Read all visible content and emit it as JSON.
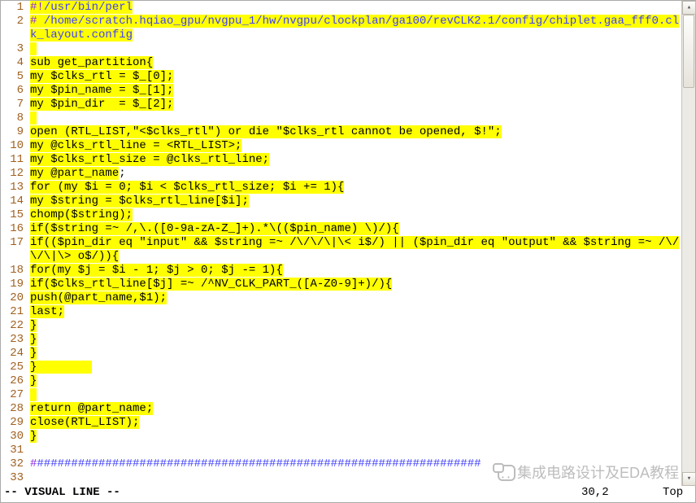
{
  "status": {
    "mode": "-- VISUAL LINE --",
    "pos": "30,2",
    "top": "Top"
  },
  "watermark": "集成电路设计及EDA教程",
  "gutter": [
    "1",
    "2",
    "",
    "3",
    "4",
    "5",
    "6",
    "7",
    "8",
    "9",
    "10",
    "11",
    "12",
    "13",
    "14",
    "15",
    "16",
    "17",
    "",
    "18",
    "19",
    "20",
    "21",
    "22",
    "23",
    "24",
    "25",
    "26",
    "27",
    "28",
    "29",
    "30",
    "31",
    "32",
    "33"
  ],
  "lines": [
    {
      "segs": [
        {
          "t": "#!",
          "c": "syn-pre sel"
        },
        {
          "t": "/usr/bin/perl",
          "c": "syn-cmt sel"
        }
      ]
    },
    {
      "segs": [
        {
          "t": "#",
          "c": "syn-hash sel"
        },
        {
          "t": " /home/scratch.hqiao_gpu/nvgpu_1/hw/nvgpu/clockplan/ga100/revCLK2.1/config/chiplet.gaa_fff0.clk_layout.config",
          "c": "syn-cmt sel"
        }
      ]
    },
    {
      "segs": [
        {
          "t": " ",
          "c": "sel"
        }
      ]
    },
    {
      "segs": [
        {
          "t": "sub get_partition{",
          "c": "sel"
        }
      ]
    },
    {
      "segs": [
        {
          "t": "my $clks_rtl = $_[0];",
          "c": "sel"
        }
      ]
    },
    {
      "segs": [
        {
          "t": "my $pin_name = $_[1];",
          "c": "sel"
        }
      ]
    },
    {
      "segs": [
        {
          "t": "my $pin_dir  = $_[2];",
          "c": "sel"
        }
      ]
    },
    {
      "segs": [
        {
          "t": " ",
          "c": "sel"
        }
      ]
    },
    {
      "segs": [
        {
          "t": "open (RTL_LIST,\"<$clks_rtl\") or die \"$clks_rtl cannot be opened, $!\";",
          "c": "sel"
        }
      ]
    },
    {
      "segs": [
        {
          "t": "my @clks_rtl_line = <RTL_LIST>;",
          "c": "sel"
        }
      ]
    },
    {
      "segs": [
        {
          "t": "my $clks_rtl_size = @clks_rtl_line;",
          "c": "sel"
        }
      ]
    },
    {
      "segs": [
        {
          "t": "my @part_name",
          "c": "sel"
        },
        {
          "t": ";",
          "c": ""
        }
      ]
    },
    {
      "segs": [
        {
          "t": "for (my $i = 0; $i < $clks_rtl_size; $i += 1){",
          "c": "sel"
        }
      ]
    },
    {
      "segs": [
        {
          "t": "my $string = $clks_rtl_line[$i];",
          "c": "sel"
        }
      ]
    },
    {
      "segs": [
        {
          "t": "chomp($string);",
          "c": "sel"
        }
      ]
    },
    {
      "segs": [
        {
          "t": "if($string =~ /,\\.([0-9a-zA-Z_]+).*\\(($pin_name) \\)/){",
          "c": "sel"
        }
      ]
    },
    {
      "segs": [
        {
          "t": "if(($pin_dir eq \"input\" && $string =~ /\\/\\/\\|\\< i$/) || ($pin_dir eq \"output\" && $string =~ /\\/\\/\\|\\> o$/)){",
          "c": "sel"
        }
      ]
    },
    {
      "segs": [
        {
          "t": "for(my $j = $i - 1; $j > 0; $j -= 1){",
          "c": "sel"
        }
      ]
    },
    {
      "segs": [
        {
          "t": "if($clks_rtl_line[$j] =~ /^NV_CLK_PART_([A-Z0-9]+)/){",
          "c": "sel"
        }
      ]
    },
    {
      "segs": [
        {
          "t": "push(@part_name,$1);",
          "c": "sel"
        }
      ]
    },
    {
      "segs": [
        {
          "t": "last;",
          "c": "sel"
        }
      ]
    },
    {
      "segs": [
        {
          "t": "}",
          "c": "sel"
        }
      ]
    },
    {
      "segs": [
        {
          "t": "}",
          "c": "sel"
        }
      ]
    },
    {
      "segs": [
        {
          "t": "}",
          "c": "sel"
        }
      ]
    },
    {
      "segs": [
        {
          "t": "}",
          "c": "sel"
        },
        {
          "t": "        ",
          "c": "sel"
        }
      ]
    },
    {
      "segs": [
        {
          "t": "}",
          "c": "sel"
        }
      ]
    },
    {
      "segs": [
        {
          "t": " ",
          "c": "sel"
        }
      ]
    },
    {
      "segs": [
        {
          "t": "return @part_name;",
          "c": "sel"
        }
      ]
    },
    {
      "segs": [
        {
          "t": "close(RTL_LIST);",
          "c": "sel"
        }
      ]
    },
    {
      "segs": [
        {
          "t": "}",
          "c": "sel"
        }
      ]
    },
    {
      "segs": [
        {
          "t": "",
          "c": ""
        }
      ]
    },
    {
      "segs": [
        {
          "t": "#",
          "c": "syn-hash"
        },
        {
          "t": "########################################################",
          "c": "syn-cmt"
        },
        {
          "t": "#########",
          "c": "syn-cmt"
        }
      ]
    },
    {
      "segs": [
        {
          "t": "",
          "c": ""
        }
      ]
    }
  ]
}
